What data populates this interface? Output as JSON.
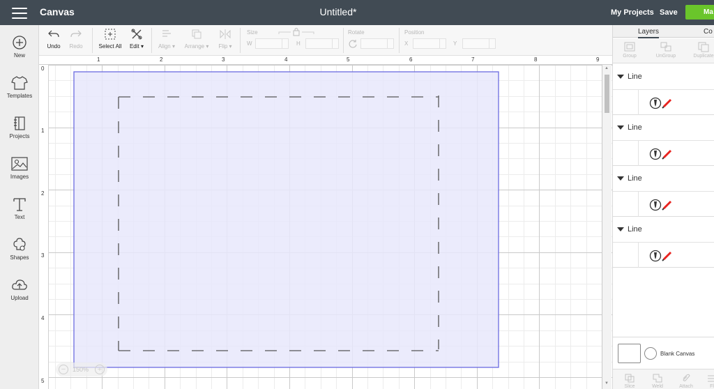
{
  "topbar": {
    "app_title": "Canvas",
    "doc_title": "Untitled*",
    "my_projects": "My Projects",
    "save": "Save",
    "make": "Ma"
  },
  "sidebar": {
    "items": [
      {
        "label": "New",
        "icon": "plus-circle-icon"
      },
      {
        "label": "Templates",
        "icon": "tshirt-icon"
      },
      {
        "label": "Projects",
        "icon": "notebook-icon"
      },
      {
        "label": "Images",
        "icon": "image-icon"
      },
      {
        "label": "Text",
        "icon": "text-t-icon"
      },
      {
        "label": "Shapes",
        "icon": "shapes-icon"
      },
      {
        "label": "Upload",
        "icon": "cloud-upload-icon"
      }
    ]
  },
  "toolbar": {
    "undo": "Undo",
    "redo": "Redo",
    "select_all": "Select All",
    "edit": "Edit",
    "align": "Align",
    "arrange": "Arrange",
    "flip": "Flip",
    "size": "Size",
    "w": "W",
    "h": "H",
    "rotate": "Rotate",
    "position": "Position",
    "x": "X",
    "y": "Y"
  },
  "canvas": {
    "ruler_top": [
      "1",
      "2",
      "3",
      "4",
      "5",
      "6",
      "7",
      "8",
      "9"
    ],
    "ruler_left": [
      "0",
      "1",
      "2",
      "3",
      "4",
      "5"
    ],
    "zoom": "150%",
    "zoom_minus": "−",
    "zoom_plus": "+"
  },
  "right_panel": {
    "tabs": [
      "Layers",
      "Co"
    ],
    "tools": [
      "Group",
      "UnGroup",
      "Duplicate"
    ],
    "layers": [
      {
        "name": "Line"
      },
      {
        "name": "Line"
      },
      {
        "name": "Line"
      },
      {
        "name": "Line"
      }
    ],
    "blank_canvas": "Blank Canvas",
    "bottom_tools": [
      "Slice",
      "Weld",
      "Attach",
      "Fl"
    ]
  },
  "colors": {
    "topbar": "#414b54",
    "make_button": "#6ac52b",
    "selection_fill": "#e8e8fc",
    "selection_stroke": "#6b6be0",
    "dash": "#555555",
    "accent_red": "#e8231f"
  }
}
